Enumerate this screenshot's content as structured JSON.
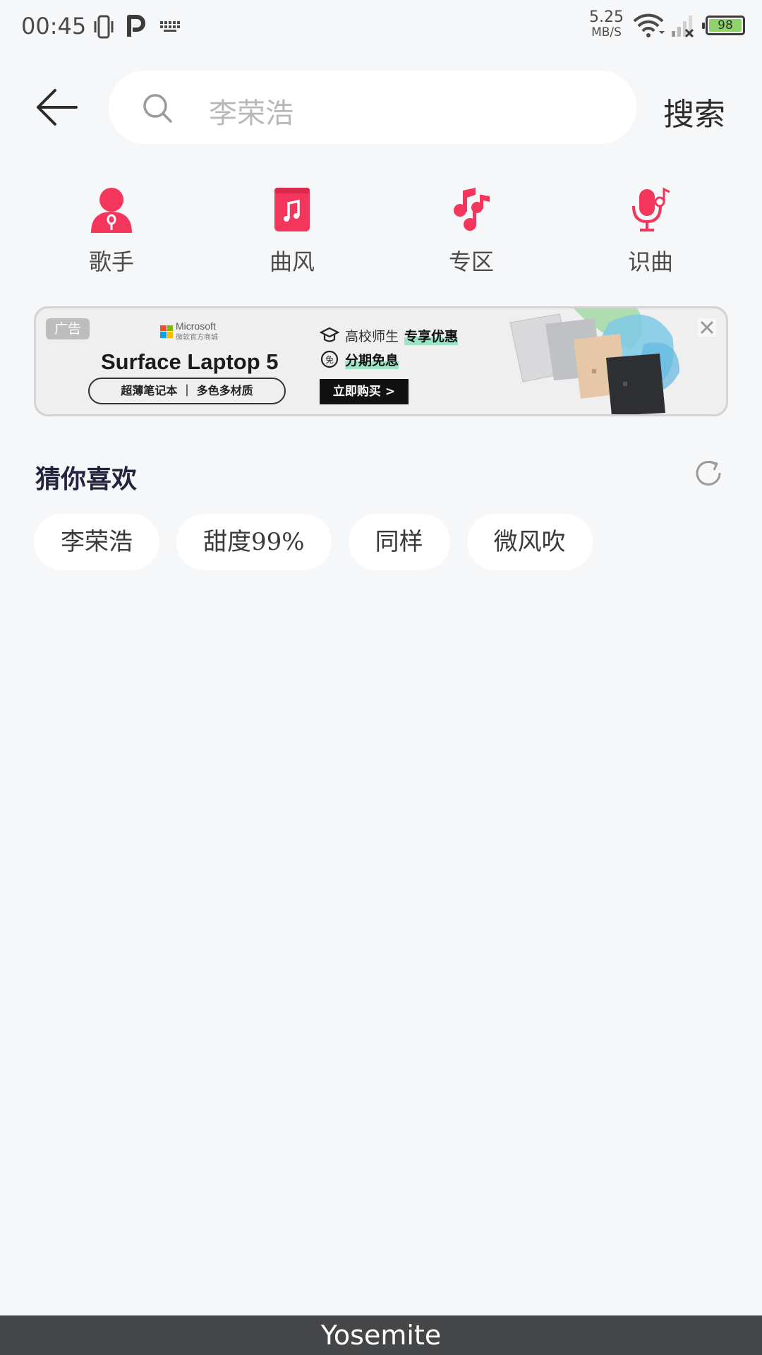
{
  "status_bar": {
    "time": "00:45",
    "net_speed_value": "5.25",
    "net_speed_unit": "MB/S",
    "battery_level": "98",
    "icons": [
      "vibrate-icon",
      "parking-p-icon",
      "keyboard-icon",
      "wifi-icon",
      "signal-icon",
      "battery-icon"
    ]
  },
  "search": {
    "placeholder": "李荣浩",
    "button_label": "搜索"
  },
  "categories": [
    {
      "label": "歌手",
      "icon": "singer-icon",
      "color": "#f5365c"
    },
    {
      "label": "曲风",
      "icon": "music-book-icon",
      "color": "#f5365c"
    },
    {
      "label": "专区",
      "icon": "music-notes-icon",
      "color": "#f5365c"
    },
    {
      "label": "识曲",
      "icon": "mic-note-icon",
      "color": "#f5365c"
    }
  ],
  "ad": {
    "tag": "广告",
    "brand": "Microsoft",
    "brand_sub": "微软官方商城",
    "title": "Surface Laptop 5",
    "pill": "超薄笔记本 ｜ 多色多材质",
    "line1_a": "高校师生",
    "line1_b": "专享优惠",
    "line2": "分期免息",
    "buy_button": "立即购买 >"
  },
  "guess": {
    "title": "猜你喜欢",
    "tags": [
      "李荣浩",
      "甜度99%",
      "同样",
      "微风吹"
    ]
  },
  "bottom_bar": {
    "label": "Yosemite"
  },
  "colors": {
    "accent": "#f5365c",
    "background": "#f6f7f9"
  }
}
